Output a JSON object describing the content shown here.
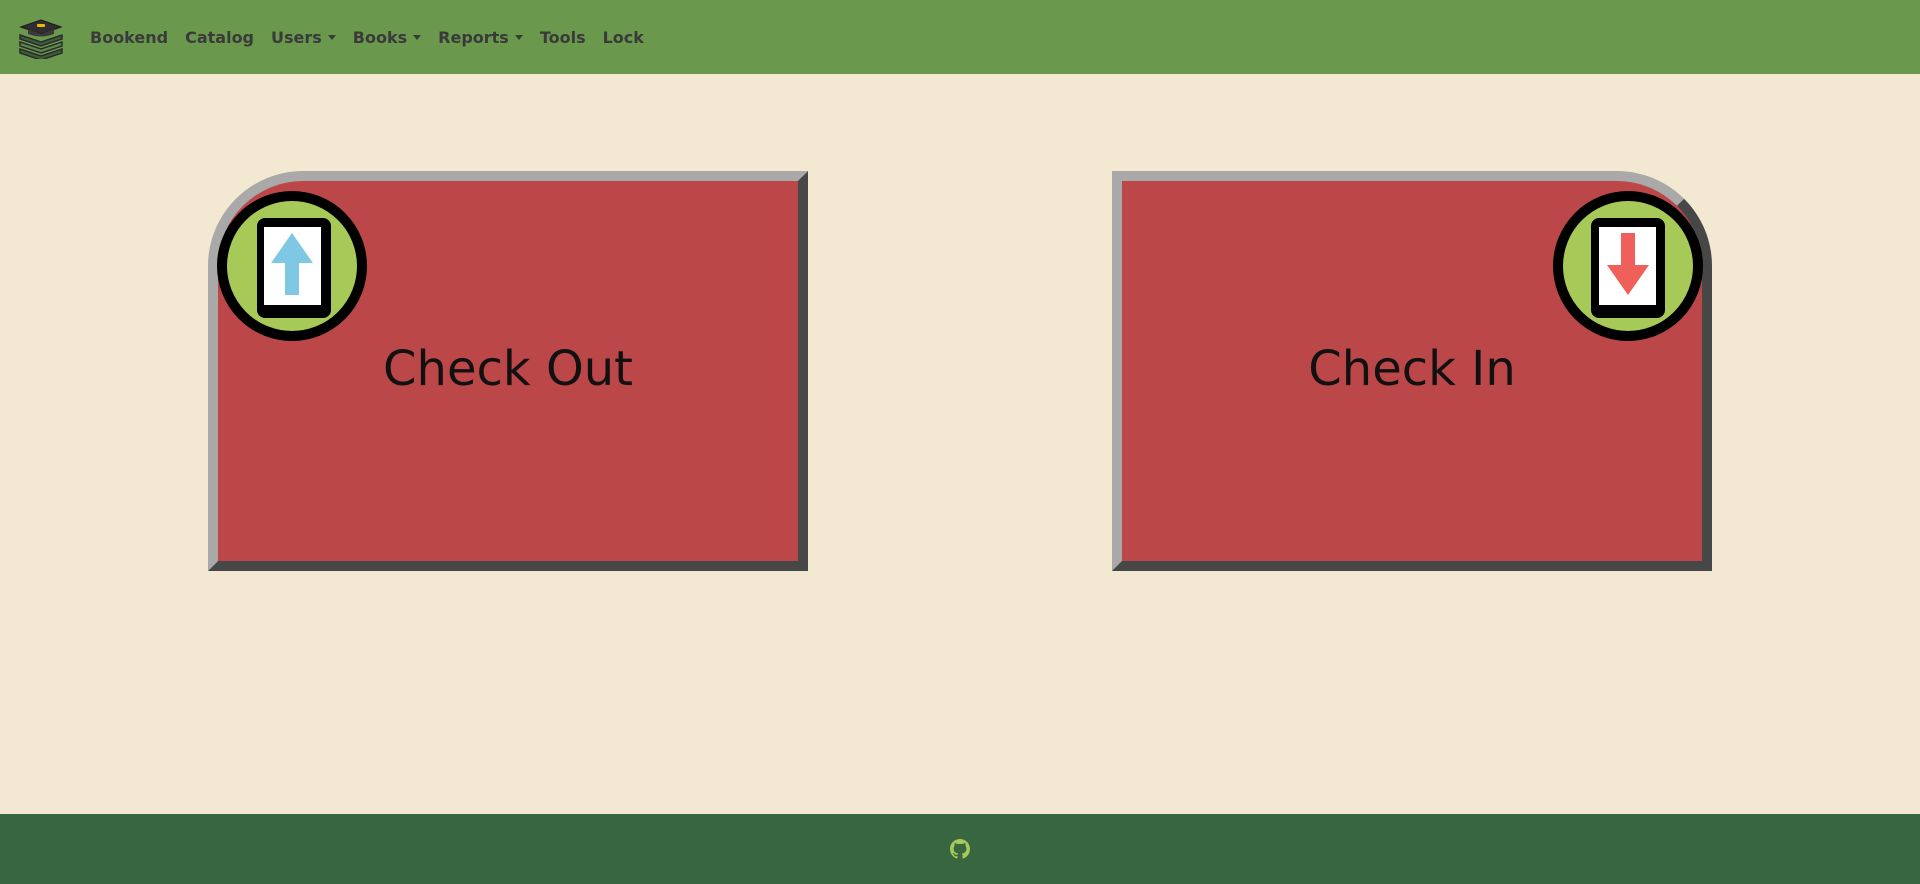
{
  "navbar": {
    "logo_icon": "book-stack-icon",
    "items": [
      {
        "label": "Bookend",
        "dropdown": false
      },
      {
        "label": "Catalog",
        "dropdown": false
      },
      {
        "label": "Users",
        "dropdown": true
      },
      {
        "label": "Books",
        "dropdown": true
      },
      {
        "label": "Reports",
        "dropdown": true
      },
      {
        "label": "Tools",
        "dropdown": false
      },
      {
        "label": "Lock",
        "dropdown": false
      }
    ]
  },
  "actions": {
    "checkout": {
      "label": "Check Out",
      "icon": "phone-arrow-up-icon",
      "arrow_color": "#7ec8e3"
    },
    "checkin": {
      "label": "Check In",
      "icon": "phone-arrow-down-icon",
      "arrow_color": "#f0605a"
    }
  },
  "footer": {
    "icon": "github-icon"
  },
  "colors": {
    "navbar": "#6a994e",
    "background": "#f3e8d1",
    "card": "#bc4749",
    "badge": "#a7c957",
    "footer": "#386641"
  }
}
